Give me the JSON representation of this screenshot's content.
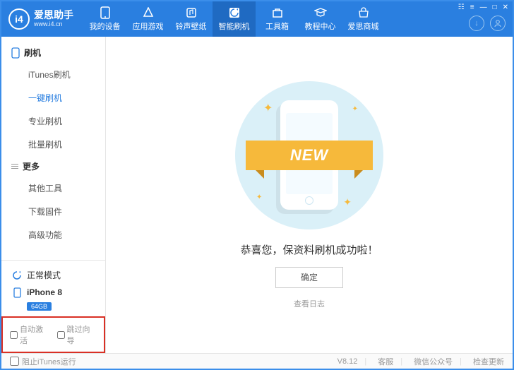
{
  "logo": {
    "mark": "i4",
    "title": "爱思助手",
    "sub": "www.i4.cn"
  },
  "tabs": [
    {
      "label": "我的设备"
    },
    {
      "label": "应用游戏"
    },
    {
      "label": "铃声壁纸"
    },
    {
      "label": "智能刷机"
    },
    {
      "label": "工具箱"
    },
    {
      "label": "教程中心"
    },
    {
      "label": "爱思商城"
    }
  ],
  "sidebar": {
    "group1": {
      "title": "刷机",
      "items": [
        "iTunes刷机",
        "一键刷机",
        "专业刷机",
        "批量刷机"
      ]
    },
    "group2": {
      "title": "更多",
      "items": [
        "其他工具",
        "下载固件",
        "高级功能"
      ]
    },
    "mode": "正常模式",
    "device": {
      "name": "iPhone 8",
      "storage": "64GB"
    },
    "checks": {
      "auto": "自动激活",
      "skip": "跳过向导"
    }
  },
  "main": {
    "ribbon": "NEW",
    "message": "恭喜您，保资料刷机成功啦！",
    "ok": "确定",
    "log": "查看日志"
  },
  "footer": {
    "prevent": "阻止iTunes运行",
    "version": "V8.12",
    "support": "客服",
    "wechat": "微信公众号",
    "update": "检查更新"
  }
}
